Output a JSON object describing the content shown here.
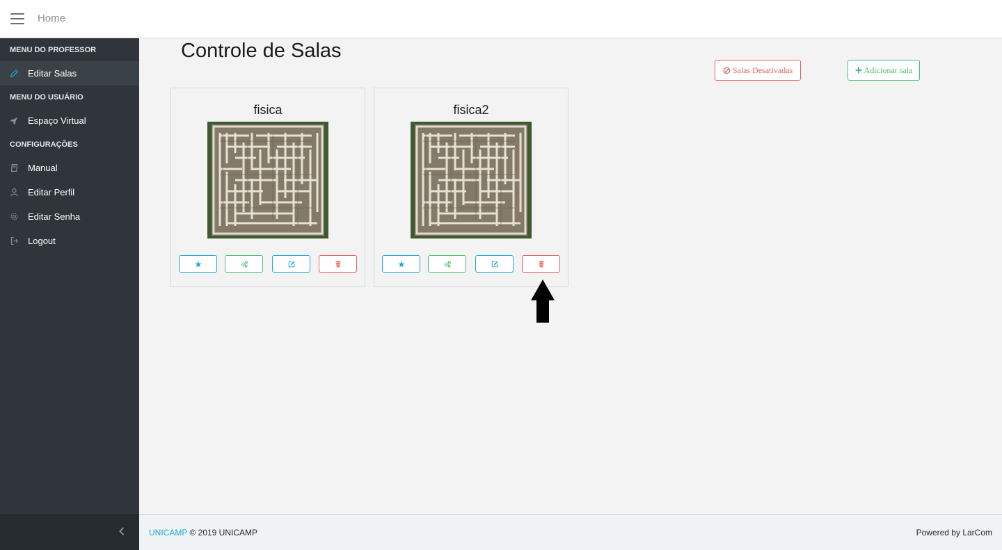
{
  "header": {
    "home_label": "Home"
  },
  "sidebar": {
    "sections": [
      {
        "title": "MENU DO PROFESSOR",
        "items": [
          {
            "label": "Editar Salas",
            "icon": "pencil-icon",
            "active": true
          }
        ]
      },
      {
        "title": "MENU DO USUÁRIO",
        "items": [
          {
            "label": "Espaço Virtual",
            "icon": "rocket-icon"
          }
        ]
      },
      {
        "title": "CONFIGURAÇÕES",
        "items": [
          {
            "label": "Manual",
            "icon": "book-icon"
          },
          {
            "label": "Editar Perfil",
            "icon": "user-icon"
          },
          {
            "label": "Editar Senha",
            "icon": "settings-icon"
          },
          {
            "label": "Logout",
            "icon": "logout-icon"
          }
        ]
      }
    ]
  },
  "main": {
    "title": "Controle de Salas",
    "buttons": {
      "desativadas": "Salas Desativadas",
      "adicionar": "Adicionar sala"
    },
    "rooms": [
      {
        "name": "fisica",
        "image": "maze-image"
      },
      {
        "name": "fisica2",
        "image": "maze-image"
      }
    ]
  },
  "colors": {
    "primary": "#20a8d8",
    "success": "#4dbd74",
    "danger": "#e5635f",
    "sidebar_bg": "#2f353a"
  },
  "footer": {
    "brand": "UNICAMP",
    "copyright": "© 2019 UNICAMP",
    "powered_prefix": "Powered by",
    "powered_link": "LarCom"
  }
}
